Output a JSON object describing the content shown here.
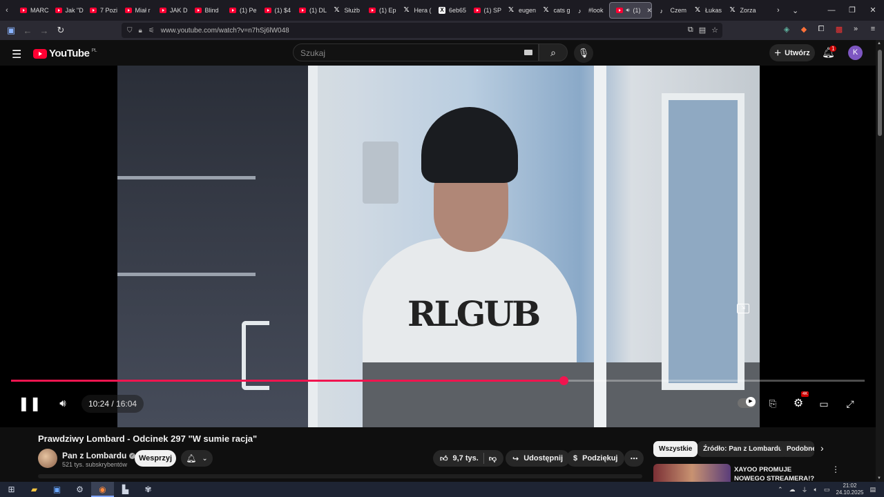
{
  "browser": {
    "tabs": [
      {
        "label": "MARC",
        "icon": "youtube-icon"
      },
      {
        "label": "Jak \"D",
        "icon": "youtube-icon"
      },
      {
        "label": "7 Pozi",
        "icon": "youtube-icon"
      },
      {
        "label": "Miał r",
        "icon": "youtube-icon"
      },
      {
        "label": "JAK D",
        "icon": "youtube-icon"
      },
      {
        "label": "Blind ",
        "icon": "youtube-icon"
      },
      {
        "label": "(1) Pe",
        "icon": "youtube-icon"
      },
      {
        "label": "(1) $4",
        "icon": "youtube-icon"
      },
      {
        "label": "(1) DL",
        "icon": "youtube-icon"
      },
      {
        "label": "Służb",
        "icon": "x-icon"
      },
      {
        "label": "(1) Ep",
        "icon": "youtube-icon"
      },
      {
        "label": "Hera (",
        "icon": "x-icon"
      },
      {
        "label": "6eb65",
        "icon": "github-icon"
      },
      {
        "label": "(1) SP",
        "icon": "youtube-icon"
      },
      {
        "label": "eugen",
        "icon": "x-icon"
      },
      {
        "label": "cats g",
        "icon": "x-icon"
      },
      {
        "label": "#look",
        "icon": "tiktok-icon"
      },
      {
        "label": "(1)",
        "icon": "youtube-icon",
        "active": true
      },
      {
        "label": "Czem",
        "icon": "tiktok-icon"
      },
      {
        "label": "Łukas",
        "icon": "x-icon"
      },
      {
        "label": "Zorza",
        "icon": "x-icon"
      }
    ],
    "url": "www.youtube.com/watch?v=n7hSj6lW048"
  },
  "youtube": {
    "logo_text": "YouTube",
    "region": "PL",
    "search_placeholder": "Szukaj",
    "create_label": "Utwórz",
    "notification_count": "1",
    "avatar_letter": "K",
    "avatar_color": "#7e57c2"
  },
  "player": {
    "current_time": "10:24",
    "duration": "16:04",
    "progress_fraction": 0.6473,
    "quality_badge": "4K",
    "accent_color": "#f0154f",
    "shirt_print": "RLGUB"
  },
  "video": {
    "title": "Prawdziwy Lombard - Odcinek 297 \"W sumie racja\"",
    "channel_name": "Pan z Lombardu",
    "subscribers": "521 tys. subskrybentów",
    "support_label": "Wesprzyj",
    "likes": "9,7 tys.",
    "share_label": "Udostępnij",
    "thanks_label": "Podziękuj"
  },
  "related": {
    "chips": [
      "Wszystkie",
      "Źródło: Pan z Lombardu",
      "Podobne"
    ],
    "first_title": "XAYOO PROMUJE NOWEGO STREAMERA!? RENATA I"
  },
  "system": {
    "time": "21:02",
    "date": "24.10.2025"
  }
}
